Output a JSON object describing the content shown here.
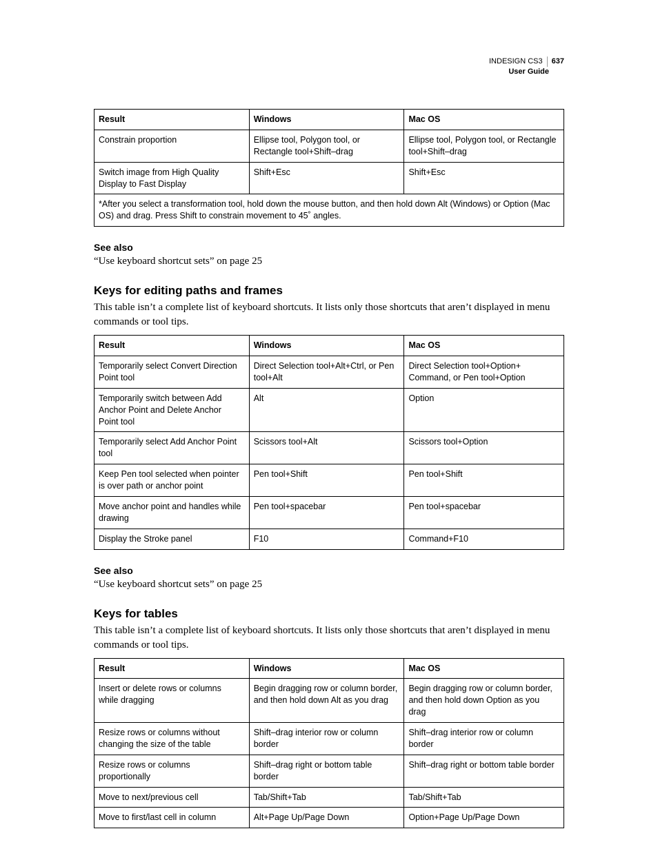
{
  "header": {
    "product": "INDESIGN CS3",
    "pgnum": "637",
    "guide": "User Guide"
  },
  "table1": {
    "head": {
      "result": "Result",
      "win": "Windows",
      "mac": "Mac OS"
    },
    "rows": [
      {
        "result": "Constrain proportion",
        "win": "Ellipse tool, Polygon tool, or Rectangle tool+Shift–drag",
        "mac": "Ellipse tool, Polygon tool, or Rectangle tool+Shift–drag"
      },
      {
        "result": "Switch image from High Quality Display to Fast Display",
        "win": "Shift+Esc",
        "mac": "Shift+Esc"
      }
    ],
    "footnote": "*After you select a transformation tool, hold down the mouse button, and then hold down Alt (Windows) or Option (Mac OS) and drag. Press Shift to constrain movement to 45˚ angles."
  },
  "seeAlso1": {
    "title": "See also",
    "text": "“Use keyboard shortcut sets” on page 25"
  },
  "section2": {
    "title": "Keys for editing paths and frames",
    "intro": "This table isn’t a complete list of keyboard shortcuts. It lists only those shortcuts that aren’t displayed in menu commands or tool tips."
  },
  "table2": {
    "head": {
      "result": "Result",
      "win": "Windows",
      "mac": "Mac OS"
    },
    "rows": [
      {
        "result": "Temporarily select Convert Direction Point tool",
        "win": "Direct Selection tool+Alt+Ctrl, or Pen tool+Alt",
        "mac": "Direct Selection tool+Option+ Command, or Pen tool+Option"
      },
      {
        "result": "Temporarily switch between Add Anchor Point and Delete Anchor Point tool",
        "win": "Alt",
        "mac": "Option"
      },
      {
        "result": "Temporarily select Add Anchor Point tool",
        "win": "Scissors tool+Alt",
        "mac": "Scissors tool+Option"
      },
      {
        "result": "Keep Pen tool selected when pointer is over path or anchor point",
        "win": "Pen tool+Shift",
        "mac": "Pen tool+Shift"
      },
      {
        "result": "Move anchor point and handles while drawing",
        "win": "Pen tool+spacebar",
        "mac": "Pen tool+spacebar"
      },
      {
        "result": "Display the Stroke panel",
        "win": "F10",
        "mac": "Command+F10"
      }
    ]
  },
  "seeAlso2": {
    "title": "See also",
    "text": "“Use keyboard shortcut sets” on page 25"
  },
  "section3": {
    "title": "Keys for tables",
    "intro": "This table isn’t a complete list of keyboard shortcuts. It lists only those shortcuts that aren’t displayed in menu commands or tool tips."
  },
  "table3": {
    "head": {
      "result": "Result",
      "win": "Windows",
      "mac": "Mac OS"
    },
    "rows": [
      {
        "result": "Insert or delete rows or columns while dragging",
        "win": "Begin dragging row or column border, and then hold down Alt as you drag",
        "mac": "Begin dragging row or column border, and then hold down Option as you drag"
      },
      {
        "result": "Resize rows or columns without changing the size of the table",
        "win": "Shift–drag interior row or column border",
        "mac": "Shift–drag interior row or column border"
      },
      {
        "result": "Resize rows or columns proportionally",
        "win": "Shift–drag right or bottom table border",
        "mac": "Shift–drag right or bottom table border"
      },
      {
        "result": "Move to next/previous cell",
        "win": "Tab/Shift+Tab",
        "mac": "Tab/Shift+Tab"
      },
      {
        "result": "Move to first/last cell in column",
        "win": "Alt+Page Up/Page Down",
        "mac": "Option+Page Up/Page Down"
      }
    ]
  }
}
